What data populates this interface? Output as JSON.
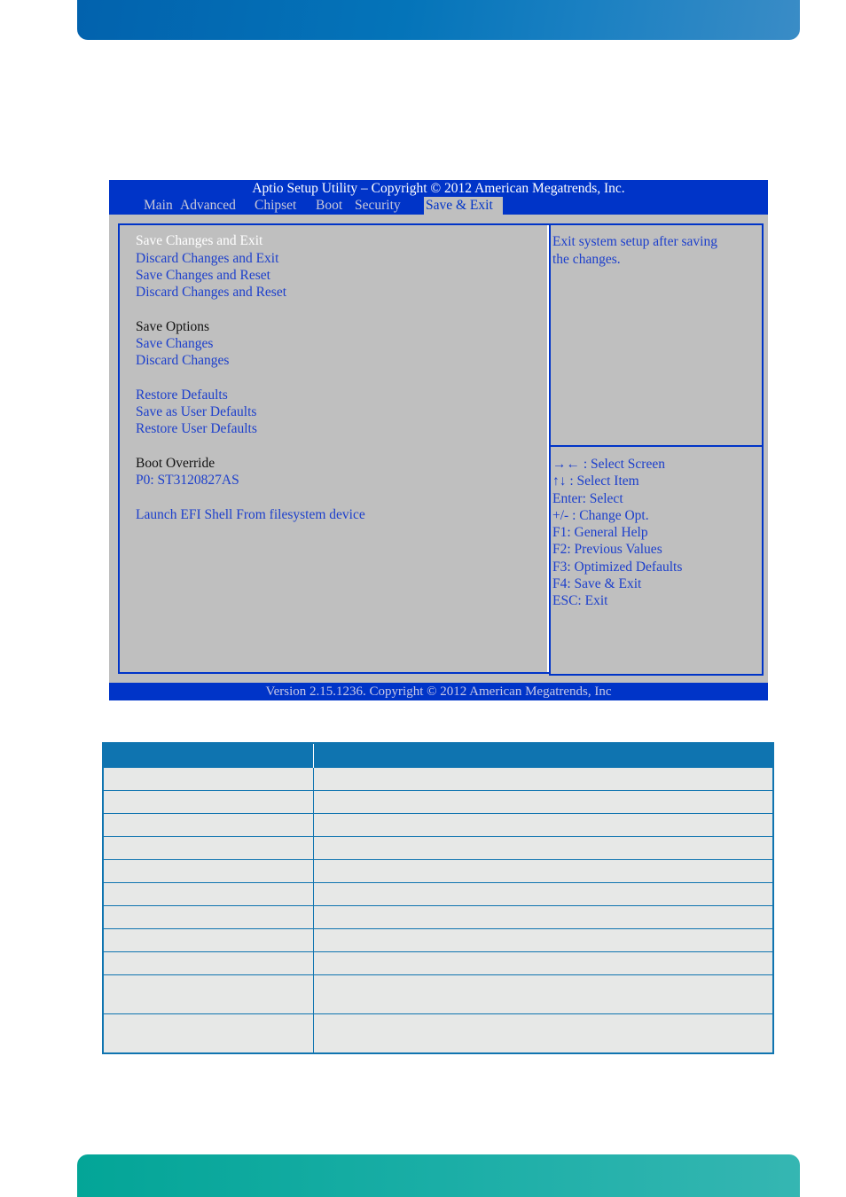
{
  "bios": {
    "title": "Aptio Setup Utility  –  Copyright © 2012 American Megatrends, Inc.",
    "tabs": [
      {
        "label": "Main",
        "active": false
      },
      {
        "label": "Advanced",
        "active": false
      },
      {
        "label": "Chipset",
        "active": false
      },
      {
        "label": "Boot",
        "active": false
      },
      {
        "label": "Security",
        "active": false
      },
      {
        "label": "Save & Exit",
        "active": true
      }
    ],
    "menu": [
      {
        "label": "Save Changes and Exit",
        "type": "item",
        "selected": true
      },
      {
        "label": "Discard Changes and Exit",
        "type": "item"
      },
      {
        "label": "Save Changes and Reset",
        "type": "item"
      },
      {
        "label": "Discard Changes and Reset",
        "type": "item"
      },
      {
        "label": "Save Options",
        "type": "label"
      },
      {
        "label": "Save Changes",
        "type": "item"
      },
      {
        "label": "Discard Changes",
        "type": "item"
      },
      {
        "label": "Restore Defaults",
        "type": "item"
      },
      {
        "label": "Save as User Defaults",
        "type": "item"
      },
      {
        "label": "Restore User Defaults",
        "type": "item"
      },
      {
        "label": "Boot Override",
        "type": "label"
      },
      {
        "label": "P0: ST3120827AS",
        "type": "item"
      },
      {
        "label": "Launch EFI Shell From filesystem device",
        "type": "item"
      }
    ],
    "help_lines": [
      "Exit system setup after saving",
      "the changes."
    ],
    "keys": [
      "→← : Select Screen",
      "↑↓ : Select Item",
      "Enter: Select",
      "+/- : Change Opt.",
      "F1: General Help",
      "F2: Previous Values",
      "F3: Optimized Defaults",
      "F4: Save & Exit",
      "ESC: Exit"
    ],
    "footer": "Version 2.15.1236. Copyright © 2012 American Megatrends, Inc"
  },
  "table": {
    "headers": [
      "",
      ""
    ],
    "rows": [
      [
        "",
        ""
      ],
      [
        "",
        ""
      ],
      [
        "",
        ""
      ],
      [
        "",
        ""
      ],
      [
        "",
        ""
      ],
      [
        "",
        ""
      ],
      [
        "",
        ""
      ],
      [
        "",
        ""
      ],
      [
        "",
        ""
      ],
      [
        "",
        ""
      ],
      [
        "",
        ""
      ]
    ]
  },
  "colors": {
    "bios_blue": "#0034c8",
    "bios_gray": "#bfbfbf",
    "bios_text": "#1c3fcc",
    "table_blue": "#0f74b0",
    "table_cell": "#e7e8e7",
    "header_band": "#0474b9",
    "footer_band": "#1aaea6"
  }
}
